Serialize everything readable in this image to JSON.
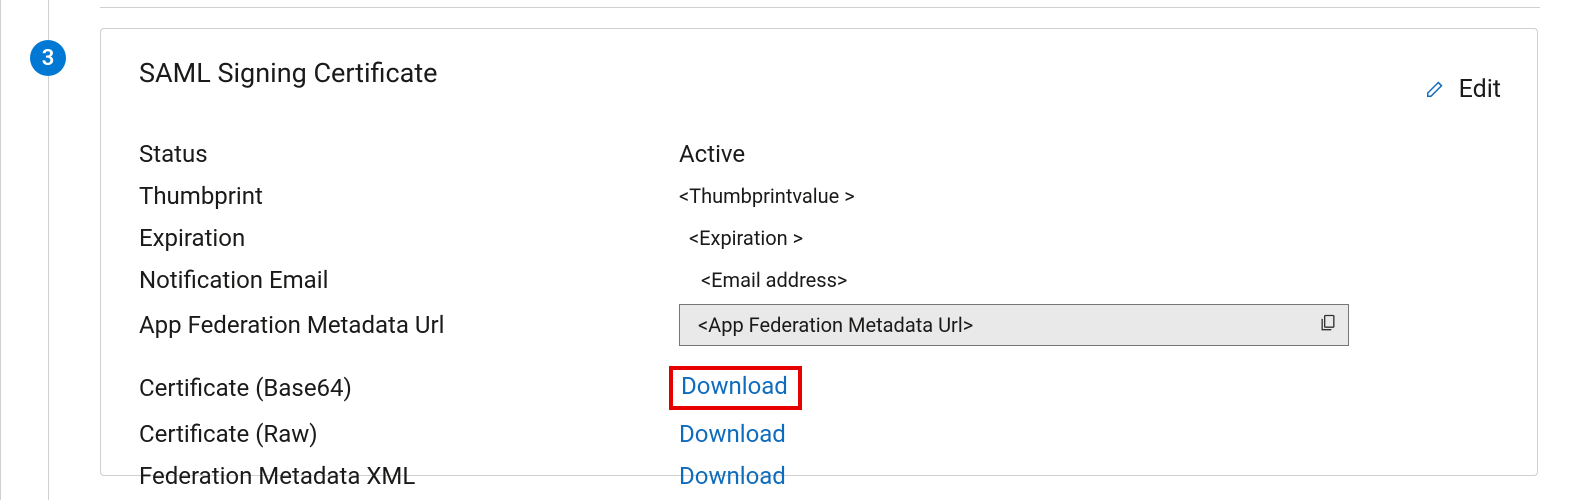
{
  "step": {
    "number": "3"
  },
  "card": {
    "title": "SAML Signing Certificate",
    "edit_label": "Edit"
  },
  "rows": {
    "status": {
      "label": "Status",
      "value": "Active"
    },
    "thumbprint": {
      "label": "Thumbprint",
      "value": "<Thumbprintvalue >"
    },
    "expiration": {
      "label": "Expiration",
      "value": "<Expiration >"
    },
    "email": {
      "label": "Notification Email",
      "value": "<Email address>"
    },
    "url": {
      "label": "App Federation Metadata Url",
      "value": "<App Federation Metadata Url>"
    },
    "cert_b64": {
      "label": "Certificate (Base64)",
      "link": "Download"
    },
    "cert_raw": {
      "label": "Certificate (Raw)",
      "link": "Download"
    },
    "fed_xml": {
      "label": "Federation Metadata XML",
      "link": "Download"
    }
  }
}
